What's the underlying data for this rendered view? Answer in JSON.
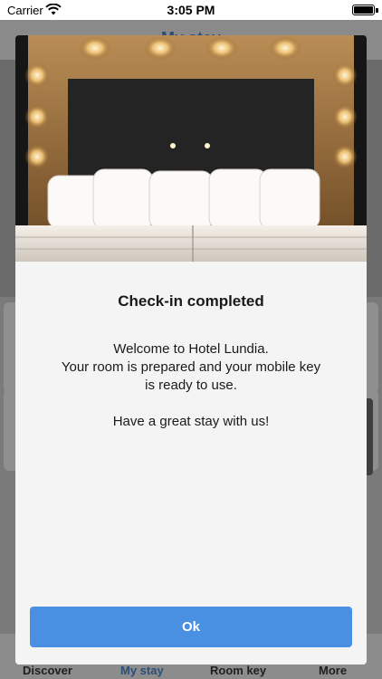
{
  "status_bar": {
    "carrier": "Carrier",
    "time": "3:05 PM"
  },
  "background": {
    "header_title": "My stay"
  },
  "tabs": [
    {
      "label": "Discover"
    },
    {
      "label": "My stay"
    },
    {
      "label": "Room key"
    },
    {
      "label": "More"
    }
  ],
  "modal": {
    "title": "Check-in completed",
    "message_lines": [
      "Welcome to Hotel Lundia.",
      "Your room is prepared and your mobile key",
      "is ready to use."
    ],
    "closing_line": "Have a great stay with us!",
    "ok_label": "Ok"
  },
  "colors": {
    "accent": "#4a90e2",
    "modal_background": "#f4f4f4",
    "overlay": "#7a7a7a",
    "tab_active": "#2d4e77"
  },
  "icons": [
    "wifi-icon",
    "battery-icon"
  ]
}
